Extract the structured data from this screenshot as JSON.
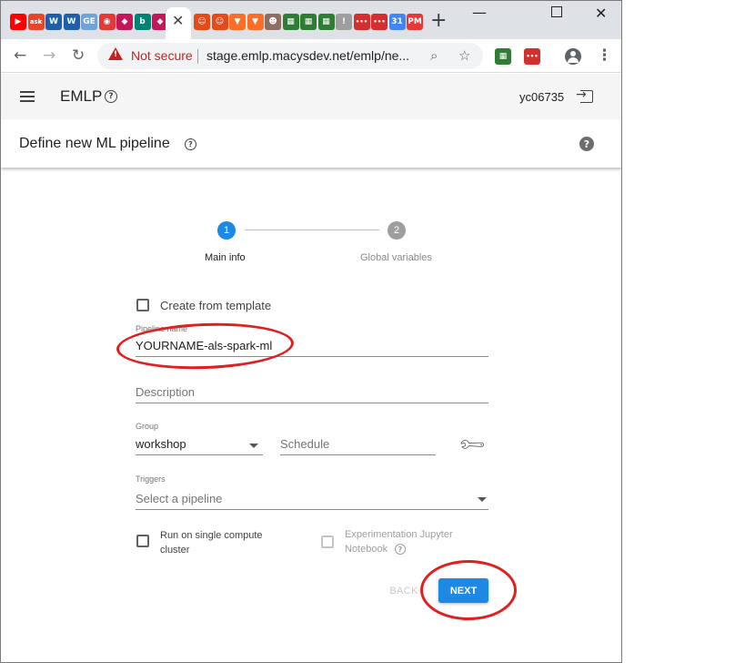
{
  "browser": {
    "favicons": [
      {
        "icon": "youtube-icon",
        "text": "▶",
        "color": "#ff0000"
      },
      {
        "icon": "ask-icon",
        "text": "ask",
        "color": "#e8452c"
      },
      {
        "icon": "w-blue-icon",
        "text": "W",
        "color": "#1f5fa8"
      },
      {
        "icon": "w-blue-icon",
        "text": "W",
        "color": "#1f5fa8"
      },
      {
        "icon": "ge-icon",
        "text": "GE",
        "color": "#6fa3d8"
      },
      {
        "icon": "wifi-red-icon",
        "text": "◉",
        "color": "#e53935"
      },
      {
        "icon": "cube-icon",
        "text": "◆",
        "color": "#c2185b"
      },
      {
        "icon": "bing-icon",
        "text": "b",
        "color": "#008373"
      },
      {
        "icon": "cube-icon",
        "text": "◆",
        "color": "#c2185b"
      }
    ],
    "favicons_after": [
      {
        "icon": "avatar-icon",
        "text": "☺",
        "color": "#e64a19"
      },
      {
        "icon": "avatar-icon",
        "text": "☺",
        "color": "#e64a19"
      },
      {
        "icon": "gitlab-icon",
        "text": "▼",
        "color": "#fc6d26"
      },
      {
        "icon": "gitlab-icon",
        "text": "▼",
        "color": "#fc6d26"
      },
      {
        "icon": "jenkins-icon",
        "text": "☻",
        "color": "#8d6e63"
      },
      {
        "icon": "grid-green-icon",
        "text": "▦",
        "color": "#2e7d32"
      },
      {
        "icon": "grid-green-icon",
        "text": "▦",
        "color": "#2e7d32"
      },
      {
        "icon": "grid-green-icon",
        "text": "▦",
        "color": "#2e7d32"
      },
      {
        "icon": "pin-icon",
        "text": "!",
        "color": "#9e9e9e"
      },
      {
        "icon": "dots-red-icon",
        "text": "•••",
        "color": "#d32f2f"
      },
      {
        "icon": "dots-red-icon",
        "text": "•••",
        "color": "#d32f2f"
      },
      {
        "icon": "calendar-icon",
        "text": "31",
        "color": "#4285f4"
      },
      {
        "icon": "pm-icon",
        "text": "PM",
        "color": "#e53935"
      }
    ],
    "security_label": "Not secure",
    "url": "stage.emlp.macysdev.net/emlp/ne..."
  },
  "app": {
    "title": "EMLP",
    "user": "yc06735"
  },
  "page": {
    "title": "Define new ML pipeline"
  },
  "stepper": {
    "steps": [
      {
        "number": "1",
        "label": "Main info",
        "active": true
      },
      {
        "number": "2",
        "label": "Global variables",
        "active": false
      }
    ]
  },
  "form": {
    "create_from_template": "Create from template",
    "pipeline_name_label": "Pipeline name",
    "pipeline_name_value": "YOURNAME-als-spark-ml",
    "description_placeholder": "Description",
    "group_label": "Group",
    "group_value": "workshop",
    "schedule_placeholder": "Schedule",
    "triggers_label": "Triggers",
    "triggers_placeholder": "Select a pipeline",
    "single_cluster_line1": "Run on single compute",
    "single_cluster_line2": "cluster",
    "jupyter_line1": "Experimentation Jupyter",
    "jupyter_line2": "Notebook",
    "back_label": "BACK",
    "next_label": "NEXT"
  },
  "colors": {
    "accent": "#1e88e5",
    "annotation": "#e02020",
    "inactive_step": "#9e9e9e"
  }
}
